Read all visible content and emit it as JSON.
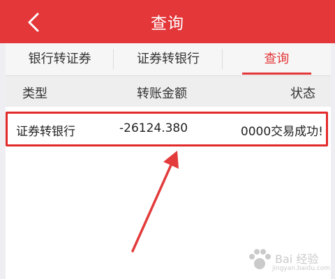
{
  "header": {
    "title": "查询",
    "back_icon": "chevron-left-icon"
  },
  "tabs": [
    {
      "label": "银行转证券",
      "active": false
    },
    {
      "label": "证券转银行",
      "active": false
    },
    {
      "label": "查询",
      "active": true
    }
  ],
  "table": {
    "columns": [
      "类型",
      "转账金额",
      "状态"
    ],
    "rows": [
      {
        "type": "证券转银行",
        "amount": "-26124.380",
        "status": "0000交易成功!"
      }
    ]
  },
  "colors": {
    "accent": "#e3373a",
    "highlight_border": "#e32a2a"
  },
  "watermark": {
    "text": "Bai 经验",
    "sub": "jingyan.baidu.com"
  }
}
